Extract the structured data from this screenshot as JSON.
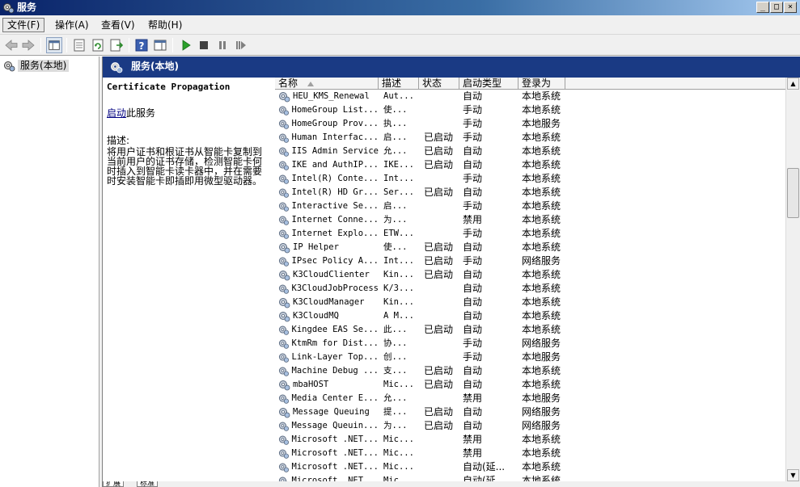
{
  "window": {
    "title": "服务"
  },
  "menu": [
    {
      "label": "文件(F)"
    },
    {
      "label": "操作(A)"
    },
    {
      "label": "查看(V)"
    },
    {
      "label": "帮助(H)"
    }
  ],
  "toolbar": {
    "buttons": [
      "back-icon",
      "forward-icon",
      "show-hide-tree-icon",
      "properties-icon",
      "refresh-icon",
      "export-list-icon",
      "help-icon",
      "show-hide-action-pane-icon",
      "start-service-icon",
      "stop-service-icon",
      "pause-service-icon",
      "resume-service-icon"
    ]
  },
  "tree": {
    "root_label": "服务(本地)"
  },
  "panel": {
    "title": "服务(本地)"
  },
  "description": {
    "service_name": "Certificate Propagation",
    "action_link": "启动",
    "action_suffix": "此服务",
    "label": "描述:",
    "text": "将用户证书和根证书从智能卡复制到当前用户的证书存储，检测智能卡何时插入到智能卡读卡器中，并在需要时安装智能卡即插即用微型驱动器。"
  },
  "table": {
    "columns": [
      "名称",
      "描述",
      "状态",
      "启动类型",
      "登录为"
    ],
    "rows": [
      {
        "name": "HEU_KMS_Renewal",
        "desc": "Aut...",
        "status": "",
        "startup": "自动",
        "logon": "本地系统"
      },
      {
        "name": "HomeGroup List...",
        "desc": "使...",
        "status": "",
        "startup": "手动",
        "logon": "本地系统"
      },
      {
        "name": "HomeGroup Prov...",
        "desc": "执...",
        "status": "",
        "startup": "手动",
        "logon": "本地服务"
      },
      {
        "name": "Human Interfac...",
        "desc": "启...",
        "status": "已启动",
        "startup": "手动",
        "logon": "本地系统"
      },
      {
        "name": "IIS Admin Service",
        "desc": "允...",
        "status": "已启动",
        "startup": "自动",
        "logon": "本地系统"
      },
      {
        "name": "IKE and AuthIP...",
        "desc": "IKE...",
        "status": "已启动",
        "startup": "自动",
        "logon": "本地系统"
      },
      {
        "name": "Intel(R) Conte...",
        "desc": "Int...",
        "status": "",
        "startup": "手动",
        "logon": "本地系统"
      },
      {
        "name": "Intel(R) HD Gr...",
        "desc": "Ser...",
        "status": "已启动",
        "startup": "自动",
        "logon": "本地系统"
      },
      {
        "name": "Interactive Se...",
        "desc": "启...",
        "status": "",
        "startup": "手动",
        "logon": "本地系统"
      },
      {
        "name": "Internet Conne...",
        "desc": "为...",
        "status": "",
        "startup": "禁用",
        "logon": "本地系统"
      },
      {
        "name": "Internet Explo...",
        "desc": "ETW...",
        "status": "",
        "startup": "手动",
        "logon": "本地系统"
      },
      {
        "name": "IP Helper",
        "desc": "使...",
        "status": "已启动",
        "startup": "自动",
        "logon": "本地系统"
      },
      {
        "name": "IPsec Policy A...",
        "desc": "Int...",
        "status": "已启动",
        "startup": "手动",
        "logon": "网络服务"
      },
      {
        "name": "K3CloudClienter",
        "desc": "Kin...",
        "status": "已启动",
        "startup": "自动",
        "logon": "本地系统"
      },
      {
        "name": "K3CloudJobProcess",
        "desc": "K/3...",
        "status": "",
        "startup": "自动",
        "logon": "本地系统"
      },
      {
        "name": "K3CloudManager",
        "desc": "Kin...",
        "status": "",
        "startup": "自动",
        "logon": "本地系统"
      },
      {
        "name": "K3CloudMQ",
        "desc": "A M...",
        "status": "",
        "startup": "自动",
        "logon": "本地系统"
      },
      {
        "name": "Kingdee EAS Se...",
        "desc": "此...",
        "status": "已启动",
        "startup": "自动",
        "logon": "本地系统"
      },
      {
        "name": "KtmRm for Dist...",
        "desc": "协...",
        "status": "",
        "startup": "手动",
        "logon": "网络服务"
      },
      {
        "name": "Link-Layer Top...",
        "desc": "创...",
        "status": "",
        "startup": "手动",
        "logon": "本地服务"
      },
      {
        "name": "Machine Debug ...",
        "desc": "支...",
        "status": "已启动",
        "startup": "自动",
        "logon": "本地系统"
      },
      {
        "name": "mbaHOST",
        "desc": "Mic...",
        "status": "已启动",
        "startup": "自动",
        "logon": "本地系统"
      },
      {
        "name": "Media Center E...",
        "desc": "允...",
        "status": "",
        "startup": "禁用",
        "logon": "本地服务"
      },
      {
        "name": "Message Queuing",
        "desc": "提...",
        "status": "已启动",
        "startup": "自动",
        "logon": "网络服务"
      },
      {
        "name": "Message Queuin...",
        "desc": "为...",
        "status": "已启动",
        "startup": "自动",
        "logon": "网络服务"
      },
      {
        "name": "Microsoft .NET...",
        "desc": "Mic...",
        "status": "",
        "startup": "禁用",
        "logon": "本地系统"
      },
      {
        "name": "Microsoft .NET...",
        "desc": "Mic...",
        "status": "",
        "startup": "禁用",
        "logon": "本地系统"
      },
      {
        "name": "Microsoft .NET...",
        "desc": "Mic...",
        "status": "",
        "startup": "自动(延...",
        "logon": "本地系统"
      },
      {
        "name": "Microsoft .NET...",
        "desc": "Mic...",
        "status": "",
        "startup": "自动(延...",
        "logon": "本地系统"
      }
    ]
  },
  "bottom_tabs": [
    "扩展",
    "标准"
  ]
}
